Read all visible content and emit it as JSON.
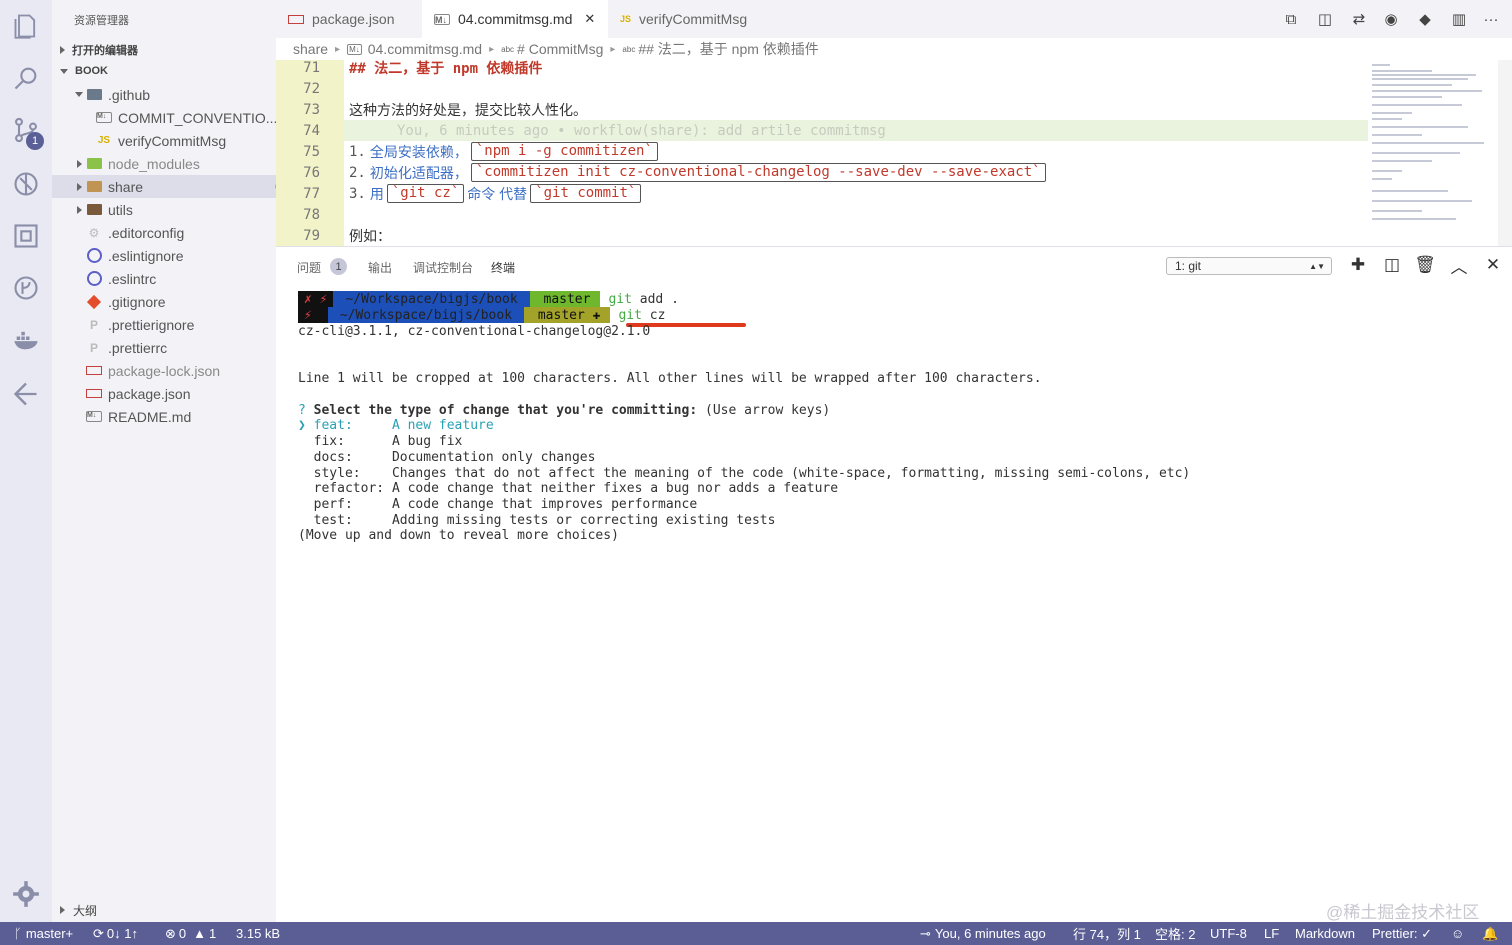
{
  "sidebar": {
    "title": "资源管理器",
    "open_editors": "打开的编辑器",
    "workspace": "BOOK",
    "items": [
      {
        "label": ".github"
      },
      {
        "label": "COMMIT_CONVENTIO..."
      },
      {
        "label": "verifyCommitMsg"
      },
      {
        "label": "node_modules"
      },
      {
        "label": "share"
      },
      {
        "label": "utils"
      },
      {
        "label": ".editorconfig"
      },
      {
        "label": ".eslintignore"
      },
      {
        "label": ".eslintrc"
      },
      {
        "label": ".gitignore"
      },
      {
        "label": ".prettierignore"
      },
      {
        "label": ".prettierrc"
      },
      {
        "label": "package-lock.json"
      },
      {
        "label": "package.json"
      },
      {
        "label": "README.md"
      }
    ],
    "outline": "大纲"
  },
  "tabs": [
    {
      "label": "package.json",
      "icon": "npm-icon"
    },
    {
      "label": "04.commitmsg.md",
      "icon": "markdown-icon"
    },
    {
      "label": "verifyCommitMsg",
      "icon": "js-icon"
    }
  ],
  "breadcrumb": {
    "folder": "share",
    "file": "04.commitmsg.md",
    "sym1": "# CommitMsg",
    "sym2": "## 法二，基于 npm 依赖插件",
    "abc": "abc",
    "md": "M↓"
  },
  "editor": {
    "line_numbers": [
      "71",
      "72",
      "73",
      "74",
      "75",
      "76",
      "77",
      "78",
      "79"
    ],
    "l71": "## 法二，基于 npm 依赖插件",
    "l73": "这种方法的好处是，提交比较人性化。",
    "l74_blame": "You, 6 minutes ago • workflow(share): add artile commitmsg",
    "l75_num": "1.",
    "l75_text": "全局安装依赖，",
    "l75_code": "`npm i -g commitizen`",
    "l76_num": "2.",
    "l76_text": "初始化适配器，",
    "l76_code": "`commitizen init cz-conventional-changelog --save-dev --save-exact`",
    "l77_num": "3.",
    "l77_text1": "用",
    "l77_code1": "`git cz`",
    "l77_text2": "命令 代替",
    "l77_code2": "`git commit`",
    "l79": "例如："
  },
  "panel": {
    "tabs": [
      "问题",
      "输出",
      "调试控制台",
      "终端"
    ],
    "problems_count": "1",
    "terminal_select": "1: git",
    "terminal": {
      "prompt1_x": "✗ ⚡",
      "prompt1_path": "~/Workspace/bigjs/book",
      "prompt1_branch": " master",
      "prompt1_cmd_git": "git",
      "prompt1_cmd_rest": " add .",
      "prompt2_x": "⚡",
      "prompt2_path": "~/Workspace/bigjs/book",
      "prompt2_branch": " master ✚",
      "prompt2_cmd_git": "git",
      "prompt2_cmd_rest": " cz",
      "version": "cz-cli@3.1.1, cz-conventional-changelog@2.1.0",
      "crop_note": "Line 1 will be cropped at 100 characters. All other lines will be wrapped after 100 characters.",
      "q_mark": "?",
      "question": "Select the type of change that you're committing:",
      "hint": " (Use arrow keys)",
      "pointer": "❯",
      "choices": [
        {
          "type": "feat:     ",
          "desc": "A new feature"
        },
        {
          "type": "fix:      ",
          "desc": "A bug fix"
        },
        {
          "type": "docs:     ",
          "desc": "Documentation only changes"
        },
        {
          "type": "style:    ",
          "desc": "Changes that do not affect the meaning of the code (white-space, formatting, missing semi-colons, etc)"
        },
        {
          "type": "refactor: ",
          "desc": "A code change that neither fixes a bug nor adds a feature"
        },
        {
          "type": "perf:     ",
          "desc": "A code change that improves performance"
        },
        {
          "type": "test:     ",
          "desc": "Adding missing tests or correcting existing tests"
        }
      ],
      "more": "(Move up and down to reveal more choices)"
    }
  },
  "status": {
    "branch": "master+",
    "sync": "0↓ 1↑",
    "errors": "0",
    "warnings": "1",
    "size": "3.15 kB",
    "blame": "You, 6 minutes ago",
    "position": "行 74，列 1",
    "spaces": "空格: 2",
    "encoding": "UTF-8",
    "eol": "LF",
    "language": "Markdown",
    "prettier": "Prettier: ✓"
  },
  "watermark": "@稀土掘金技术社区",
  "colors": {
    "statusbar": "#5b5e95",
    "accent": "#c0392b",
    "terminal_cmd": "#44aa44"
  }
}
